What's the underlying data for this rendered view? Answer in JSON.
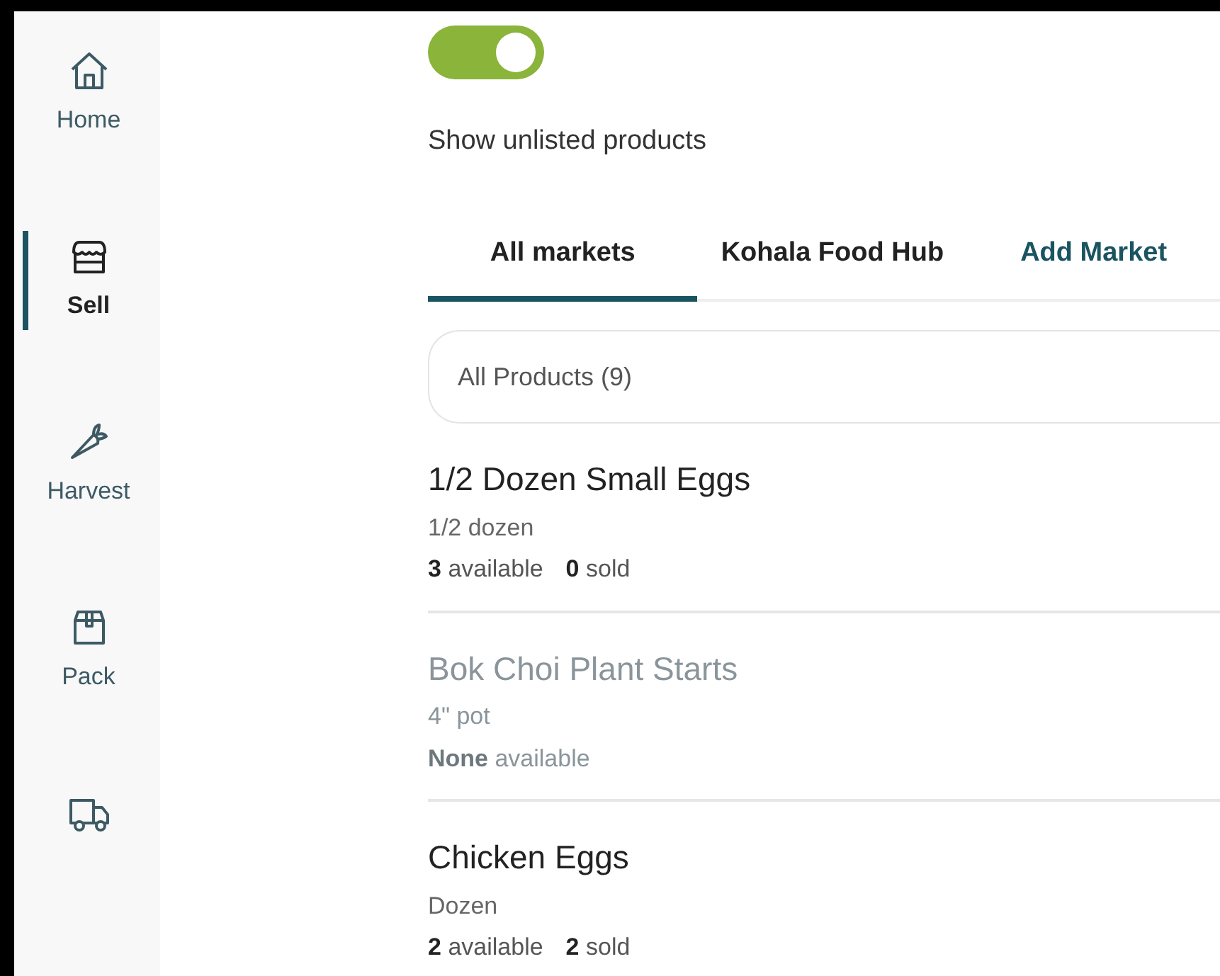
{
  "sidebar": {
    "items": [
      {
        "label": "Home",
        "selected": false
      },
      {
        "label": "Sell",
        "selected": true
      },
      {
        "label": "Harvest",
        "selected": false
      },
      {
        "label": "Pack",
        "selected": false
      },
      {
        "selected": false
      }
    ]
  },
  "unlisted_toggle": {
    "on": true,
    "label": "Show unlisted products"
  },
  "tabs": [
    {
      "label": "All markets",
      "kind": "tab",
      "selected": true
    },
    {
      "label": "Kohala Food Hub",
      "kind": "tab",
      "selected": false
    },
    {
      "label": "Add Market",
      "kind": "link",
      "selected": false
    }
  ],
  "product_filter": {
    "value": "All Products (9)"
  },
  "products": [
    {
      "name": "1/2 Dozen Small Eggs",
      "unit": "1/2 dozen",
      "unlisted": false,
      "stats": [
        "**3** available",
        "**0** sold"
      ]
    },
    {
      "name": "Bok Choi Plant Starts",
      "unit": "4\" pot",
      "unlisted": true,
      "stats": [
        "**None** available"
      ]
    },
    {
      "name": "Chicken Eggs",
      "unit": "Dozen",
      "unlisted": false,
      "stats": [
        "**2** available",
        "**2** sold"
      ]
    }
  ]
}
